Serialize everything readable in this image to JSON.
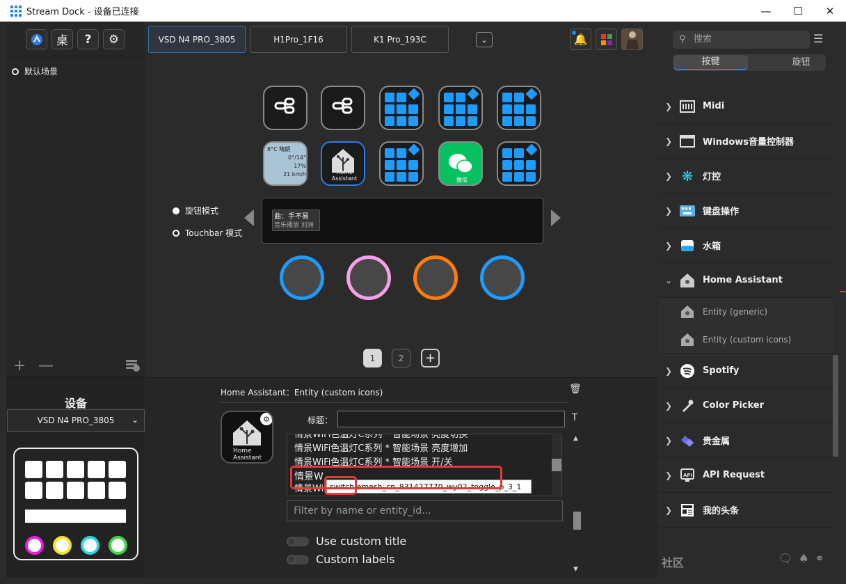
{
  "window": {
    "title": "Stream Dock - 设备已连接"
  },
  "left": {
    "scene": "默认场景",
    "device_title": "设备",
    "device_select": "VSD N4 PRO_3805",
    "preview_knob_colors": [
      "#e91ee0",
      "#f2e41b",
      "#2ad7e0",
      "#43d34a"
    ]
  },
  "tabs": [
    "VSD N4 PRO_3805",
    "H1Pro_1F16",
    "K1 Pro_193C"
  ],
  "weather": {
    "temp": "8°C 晴朗",
    "range": "0°/14°",
    "humidity": "17%",
    "wind": "21 km/h"
  },
  "ha_key": {
    "line1": "Home",
    "line2": "Assistant"
  },
  "wechat_label": "微信",
  "modes": {
    "knob": "旋钮模式",
    "touchbar": "Touchbar 模式"
  },
  "touchbar": {
    "song": "曲：手不易",
    "sub": "音乐播放",
    "artist": "刘洲"
  },
  "knob_colors": [
    "#1e9bff",
    "#f5a0e8",
    "#ff7c0a",
    "#1e9bff"
  ],
  "pages": [
    "1",
    "2",
    "+"
  ],
  "prop": {
    "header": "Home Assistant：Entity (custom icons)",
    "title_label": "标题：",
    "title_value": "",
    "list": [
      "情景WiFi色温灯C系列 * 智能场景 亮度切换",
      "情景WiFi色温灯C系列 * 智能场景 亮度增加",
      "情景WiFi色温灯C系列 * 智能场景 开/关",
      "情景W",
      "情景WiFi色温灯C系列 * 智能场景 开或切换色温"
    ],
    "tooltip": "switch.emesh_cn_831427770_wy02_toggle_p_3_1",
    "filter_placeholder": "Filter by name or entity_id...",
    "toggle1": "Use custom title",
    "toggle2": "Custom labels"
  },
  "right": {
    "search_placeholder": "搜索",
    "seg_a": "按键",
    "seg_b": "旋钮",
    "plugins": [
      "Midi",
      "Windows音量控制器",
      "灯控",
      "键盘操作",
      "水箱",
      "Home Assistant",
      "Spotify",
      "Color Picker",
      "贵金属",
      "API Request",
      "我的头条"
    ],
    "sub_items": [
      "Entity (generic)",
      "Entity (custom icons)"
    ],
    "community": "社区"
  }
}
